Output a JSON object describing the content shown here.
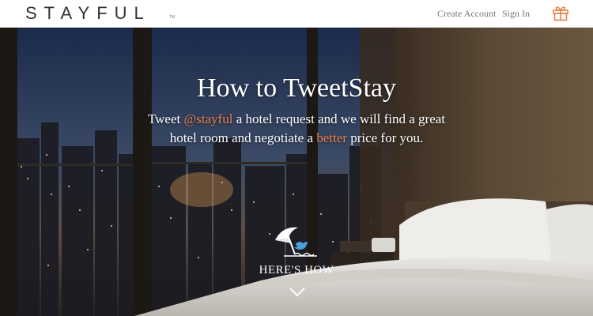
{
  "header": {
    "logo": "STAYFUL",
    "trademark": "TM",
    "create_account": "Create Account",
    "sign_in": "Sign In",
    "gift_icon": "gift-icon",
    "accent_color": "#e8814a"
  },
  "hero": {
    "title": "How to TweetStay",
    "text_part1": "Tweet ",
    "handle": "@stayful",
    "text_part2": " a hotel request and we will find a great hotel room and negotiate a ",
    "highlight": "better",
    "text_part3": " price for you.",
    "icon": "beach-umbrella-twitter-icon",
    "cta": "HERE'S HOW",
    "cta_icon": "chevron-down-icon"
  }
}
